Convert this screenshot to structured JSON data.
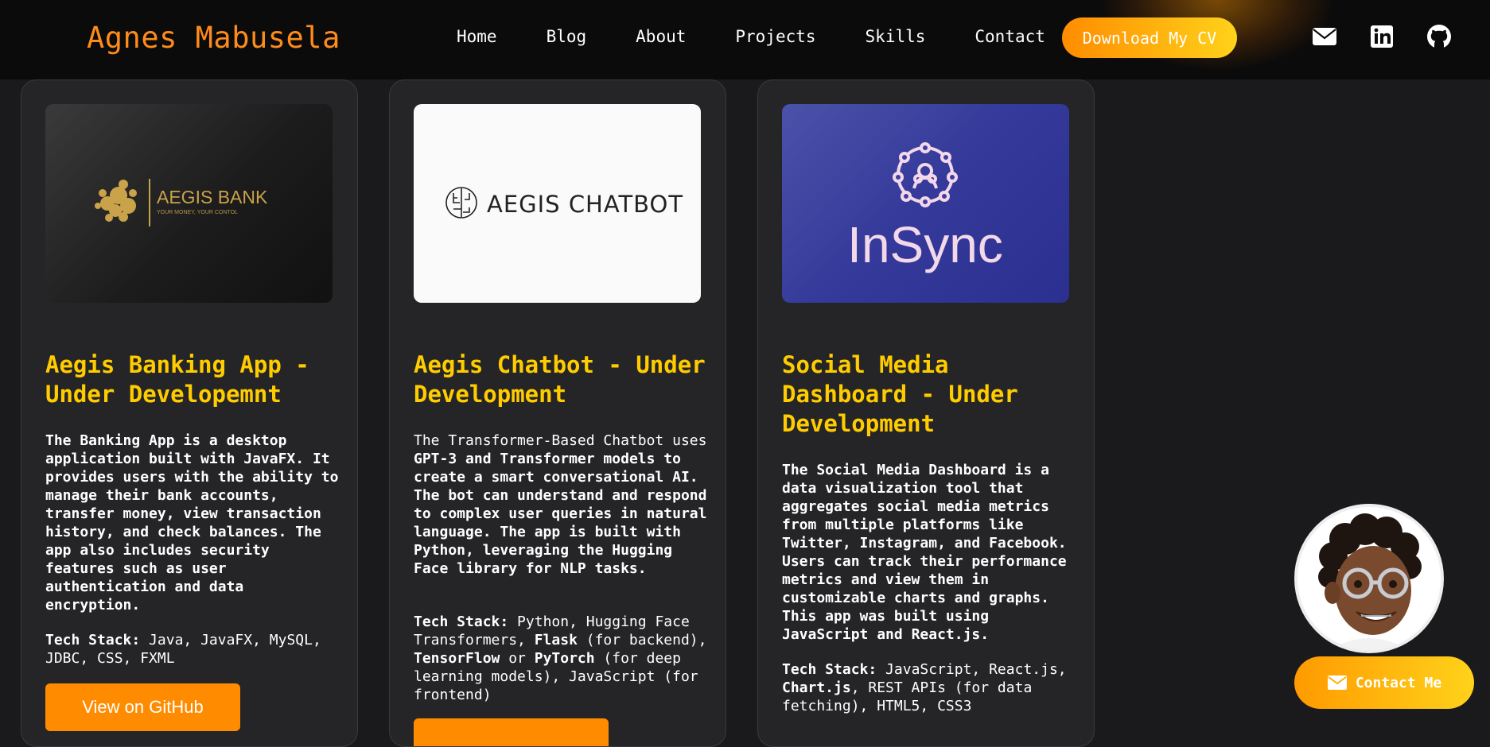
{
  "nav": {
    "brand": "Agnes Mabusela",
    "links": [
      "Home",
      "Blog",
      "About",
      "Projects",
      "Skills",
      "Contact"
    ],
    "cv_button": "Download My CV",
    "icons": [
      "envelope-icon",
      "linkedin-icon",
      "github-icon"
    ]
  },
  "projects": [
    {
      "logo_text": "AEGIS BANK",
      "logo_tagline": "YOUR MONEY, YOUR CONTOL",
      "title": "Aegis Banking App - Under Developemnt",
      "desc_1": "The Banking App is a desktop application built with ",
      "desc_b1": "JavaFX",
      "desc_2": ". It provides users with the ability to manage their bank accounts, transfer money, view transaction history, and check balances. The app also includes security features such as user authentication and data encryption.",
      "tech_label": "Tech Stack:",
      "tech": " Java, JavaFX, MySQL, JDBC, CSS, FXML",
      "button": "View on GitHub"
    },
    {
      "logo_text": "AEGIS CHATBOT",
      "title": "Aegis Chatbot - Under Development",
      "desc_1": "The Transformer-Based Chatbot uses ",
      "desc_b1": "GPT-3",
      "desc_2": " and ",
      "desc_b2": "Transformer",
      "desc_3": " models to create a smart conversational AI. The bot can understand and respond to complex user queries in natural language. The app is built with ",
      "desc_b3": "Python",
      "desc_4": ", leveraging the ",
      "desc_b4": "Hugging Face",
      "desc_5": " library for NLP tasks.",
      "tech_label": "Tech Stack:",
      "tech_1": " Python, Hugging Face Transformers, ",
      "tech_b1": "Flask",
      "tech_2": " (for backend), ",
      "tech_b2": "TensorFlow",
      "tech_3": " or ",
      "tech_b3": "PyTorch",
      "tech_4": " (for deep learning models), JavaScript (for frontend)"
    },
    {
      "logo_text": "InSync",
      "title": "Social Media Dashboard - Under Development",
      "desc_1": "The Social Media Dashboard is a data visualization tool that aggregates social media metrics from multiple platforms like Twitter, Instagram, and Facebook. Users can track their performance metrics and view them in customizable charts and graphs. This app was built using ",
      "desc_b1": "JavaScript",
      "desc_2": " and ",
      "desc_b2": "React.js",
      "desc_3": ".",
      "tech_label": "Tech Stack:",
      "tech_1": " JavaScript, React.js, ",
      "tech_b1": "Chart.js",
      "tech_2": ", REST APIs (for data fetching), HTML5, CSS3"
    }
  ],
  "contact_button": "Contact Me",
  "colors": {
    "accent": "#ff8c00",
    "title": "#ffcc00",
    "card": "#252527"
  }
}
